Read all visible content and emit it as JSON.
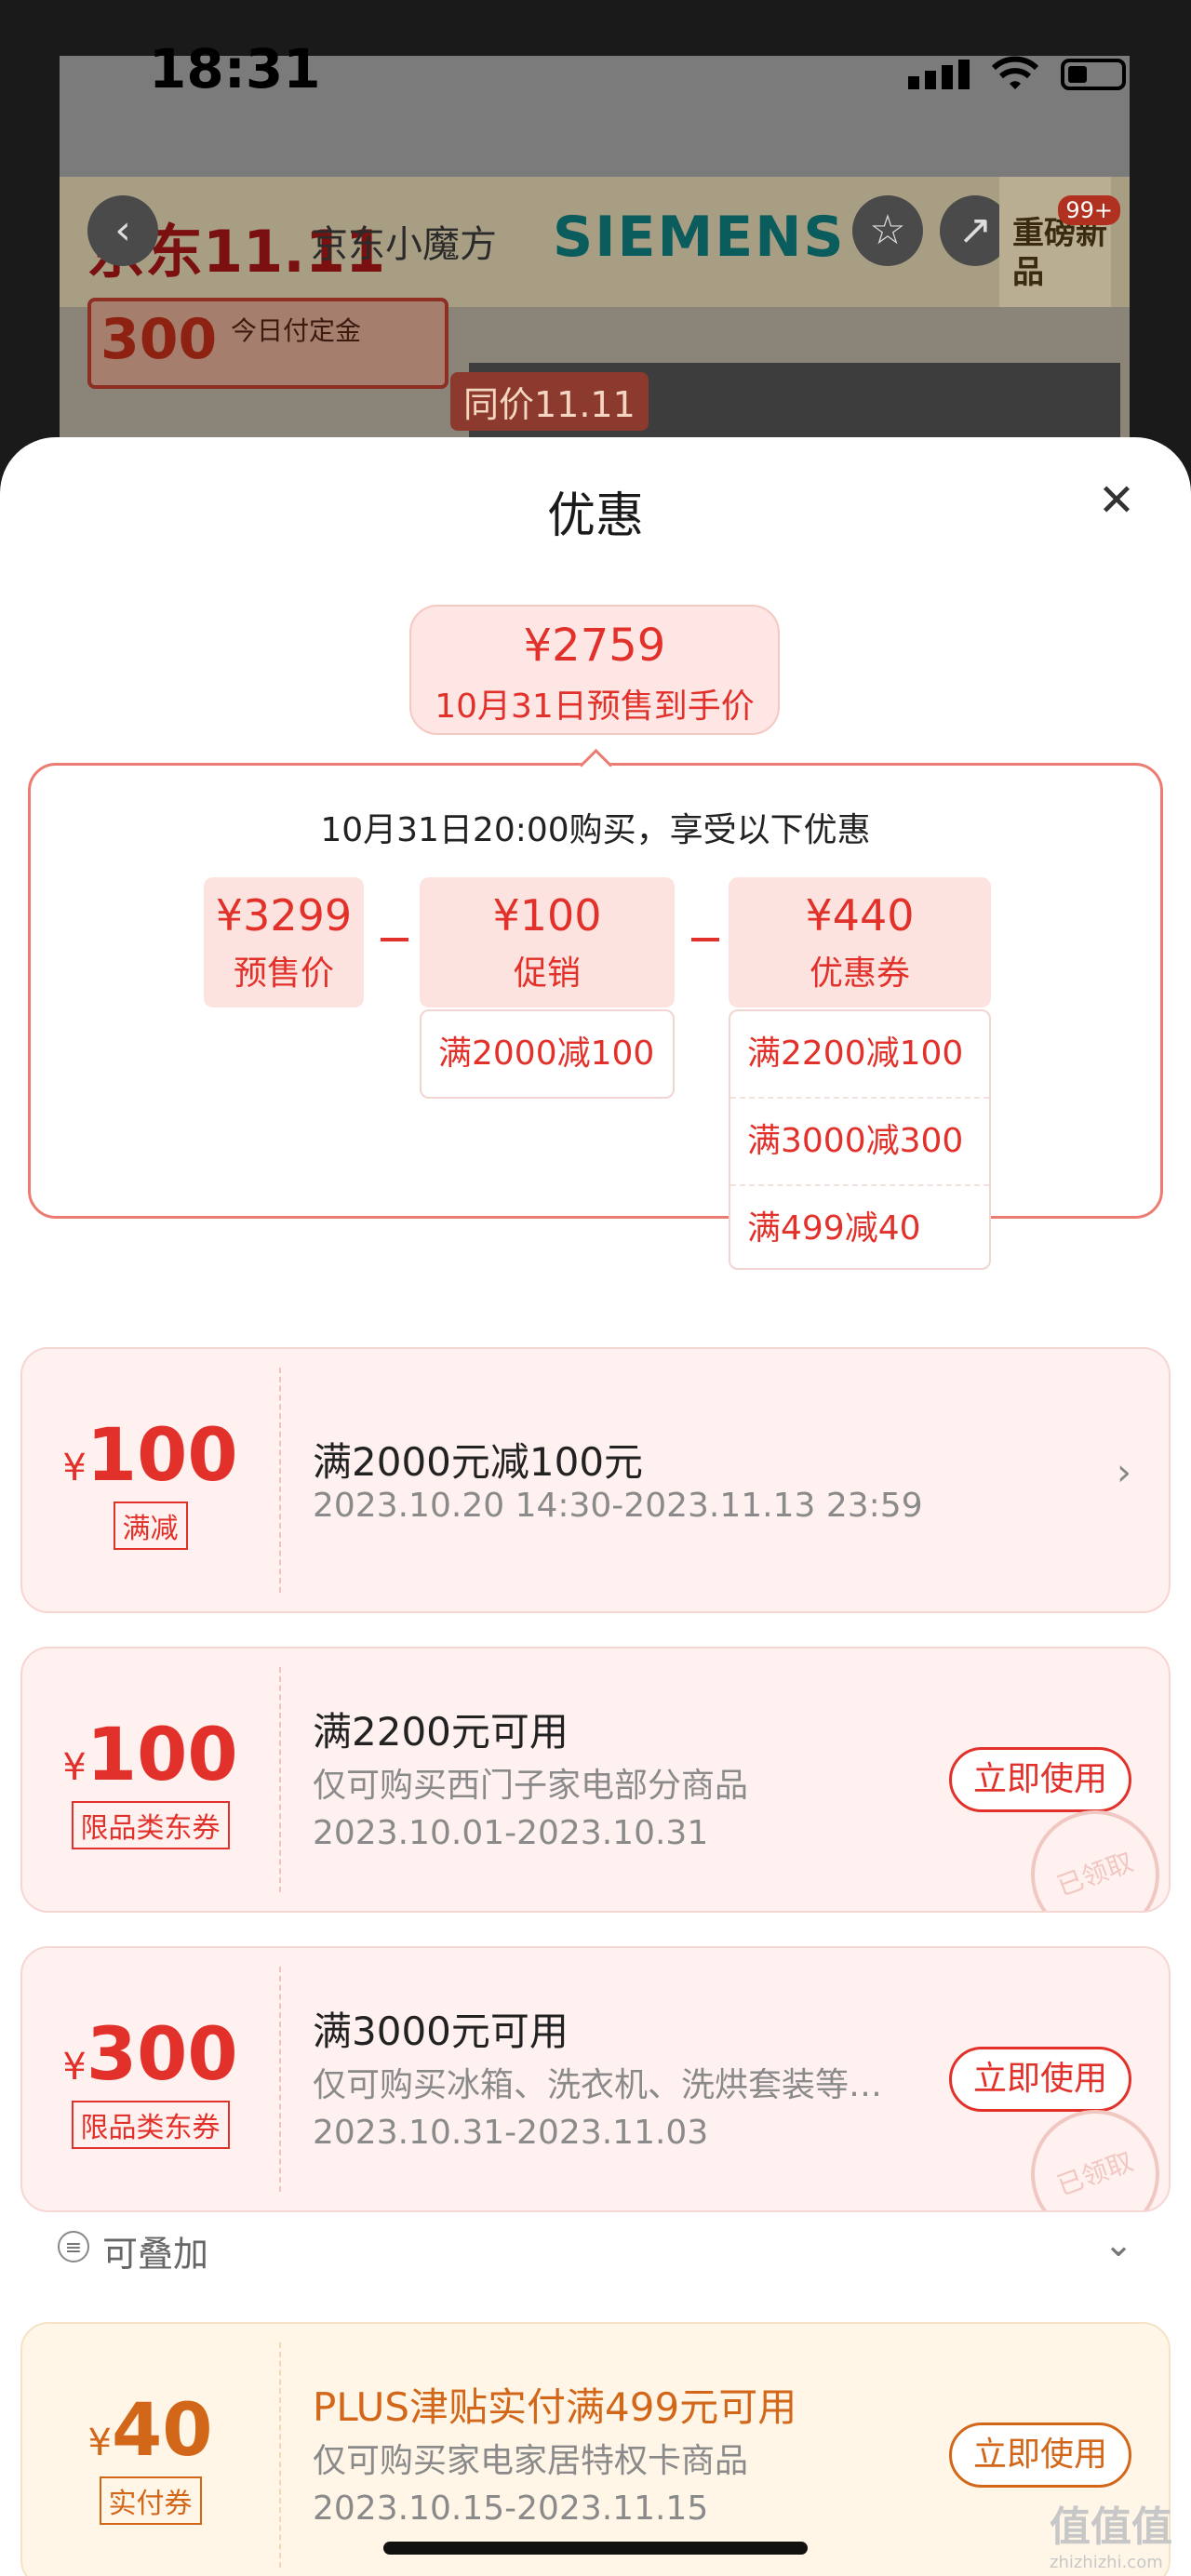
{
  "status": {
    "time": "18:31"
  },
  "background_page": {
    "jd_logo": "京东11.11",
    "mid_logo": "京东小魔方",
    "brand": "SIEMENS",
    "badge_count": "99+",
    "badge_text": "重磅新品",
    "coupon_amount": "300",
    "coupon_text": "今日付定金",
    "tag_text": "同价11.11"
  },
  "sheet": {
    "title": "优惠",
    "final_price": "¥2759",
    "final_price_label": "10月31日预售到手价",
    "calc_title": "10月31日20:00购买，享受以下优惠",
    "presale": {
      "value": "¥3299",
      "label": "预售价"
    },
    "promo": {
      "value": "¥100",
      "label": "促销",
      "items": [
        "满2000减100"
      ]
    },
    "coupon": {
      "value": "¥440",
      "label": "优惠券",
      "items": [
        "满2200减100",
        "满3000减300",
        "满499减40"
      ]
    }
  },
  "coupons": [
    {
      "symbol": "¥",
      "amount": "100",
      "tag": "满减",
      "title": "满2000元减100元",
      "date": "2023.10.20 14:30-2023.11.13 23:59"
    },
    {
      "symbol": "¥",
      "amount": "100",
      "tag": "限品类东券",
      "title": "满2200元可用",
      "desc": "仅可购买西门子家电部分商品",
      "date": "2023.10.01-2023.10.31",
      "button": "立即使用",
      "stamp": "已领取"
    },
    {
      "symbol": "¥",
      "amount": "300",
      "tag": "限品类东券",
      "title": "满3000元可用",
      "desc": "仅可购买冰箱、洗衣机、洗烘套装等…",
      "date": "2023.10.31-2023.11.03",
      "button": "立即使用",
      "stamp": "已领取"
    },
    {
      "symbol": "¥",
      "amount": "40",
      "tag": "实付券",
      "title": "PLUS津贴实付满499元可用",
      "desc": "仅可购买家电家居特权卡商品",
      "date": "2023.10.15-2023.11.15",
      "button": "立即使用"
    }
  ],
  "stackable": {
    "label": "可叠加"
  },
  "watermark": {
    "text": "值值值",
    "sub": "zhizhizhi.com"
  }
}
